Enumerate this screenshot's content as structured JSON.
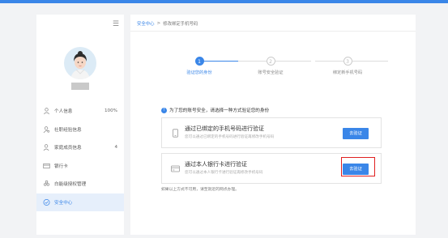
{
  "sidebar": {
    "menu_icon": "menu-lines-icon",
    "items": [
      {
        "label": "个人信息",
        "value": "100%",
        "icon": "user-icon"
      },
      {
        "label": "社职经验信息",
        "value": "",
        "icon": "user-search-icon"
      },
      {
        "label": "家庭成员信息",
        "value": "4",
        "icon": "user-group-icon"
      },
      {
        "label": "银行卡",
        "value": "",
        "icon": "card-icon"
      },
      {
        "label": "白能级授权管理",
        "value": "",
        "icon": "authorize-icon"
      },
      {
        "label": "安全中心",
        "value": "",
        "icon": "shield-icon",
        "active": true
      }
    ]
  },
  "breadcrumb": {
    "root": "安全中心",
    "separator": ">",
    "current": "修改绑定手机号码"
  },
  "steps": [
    {
      "num": "1",
      "label": "验证您的身份",
      "active": true
    },
    {
      "num": "2",
      "label": "账号安全验证",
      "active": false
    },
    {
      "num": "3",
      "label": "绑定新手机号码",
      "active": false
    }
  ],
  "tip": {
    "icon": "info-icon",
    "text": "为了您的账号安全，请选择一种方式验证您的身份"
  },
  "options": [
    {
      "title": "通过已绑定的手机号码进行验证",
      "subtitle": "您可以通过已绑定的手机号码进行验证再修改手机号码",
      "button": "去验证",
      "icon": "phone-icon"
    },
    {
      "title": "通过本人银行卡进行验证",
      "subtitle": "您可以通过本人银行卡进行验证再修改手机号码",
      "button": "去验证",
      "icon": "bank-card-icon"
    }
  ],
  "footnote": "如果以上方式不可用，请至就近的网点办理。",
  "colors": {
    "accent": "#3a86e8",
    "highlight": "#e02020"
  }
}
